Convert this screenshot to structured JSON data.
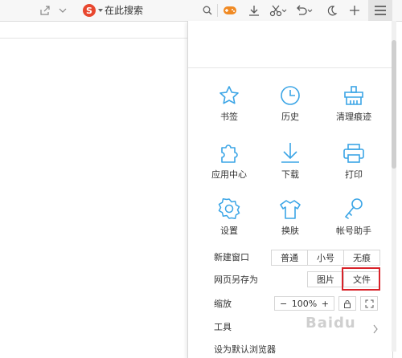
{
  "toolbar": {
    "search_placeholder": "在此搜索",
    "search_engine_letter": "S"
  },
  "menu": {
    "grid": [
      {
        "label": "书签",
        "icon": "star-icon"
      },
      {
        "label": "历史",
        "icon": "clock-icon"
      },
      {
        "label": "清理痕迹",
        "icon": "broom-icon"
      },
      {
        "label": "应用中心",
        "icon": "puzzle-icon"
      },
      {
        "label": "下载",
        "icon": "download-icon"
      },
      {
        "label": "打印",
        "icon": "printer-icon"
      },
      {
        "label": "设置",
        "icon": "gear-icon"
      },
      {
        "label": "换肤",
        "icon": "tshirt-icon"
      },
      {
        "label": "帐号助手",
        "icon": "key-icon"
      }
    ],
    "new_window": {
      "label": "新建窗口",
      "options": [
        "普通",
        "小号",
        "无痕"
      ]
    },
    "save_page": {
      "label": "网页另存为",
      "options": [
        "图片",
        "文件"
      ]
    },
    "zoom": {
      "label": "缩放",
      "minus": "−",
      "value": "100%",
      "plus": "+"
    },
    "tools": {
      "label": "工具"
    },
    "set_default": {
      "label": "设为默认浏览器"
    }
  },
  "colors": {
    "accent": "#3ba5e6",
    "highlight": "#d9232a",
    "search_logo": "#e8472f",
    "game_icon": "#f08a24"
  },
  "watermark": {
    "text": "Baidu"
  }
}
